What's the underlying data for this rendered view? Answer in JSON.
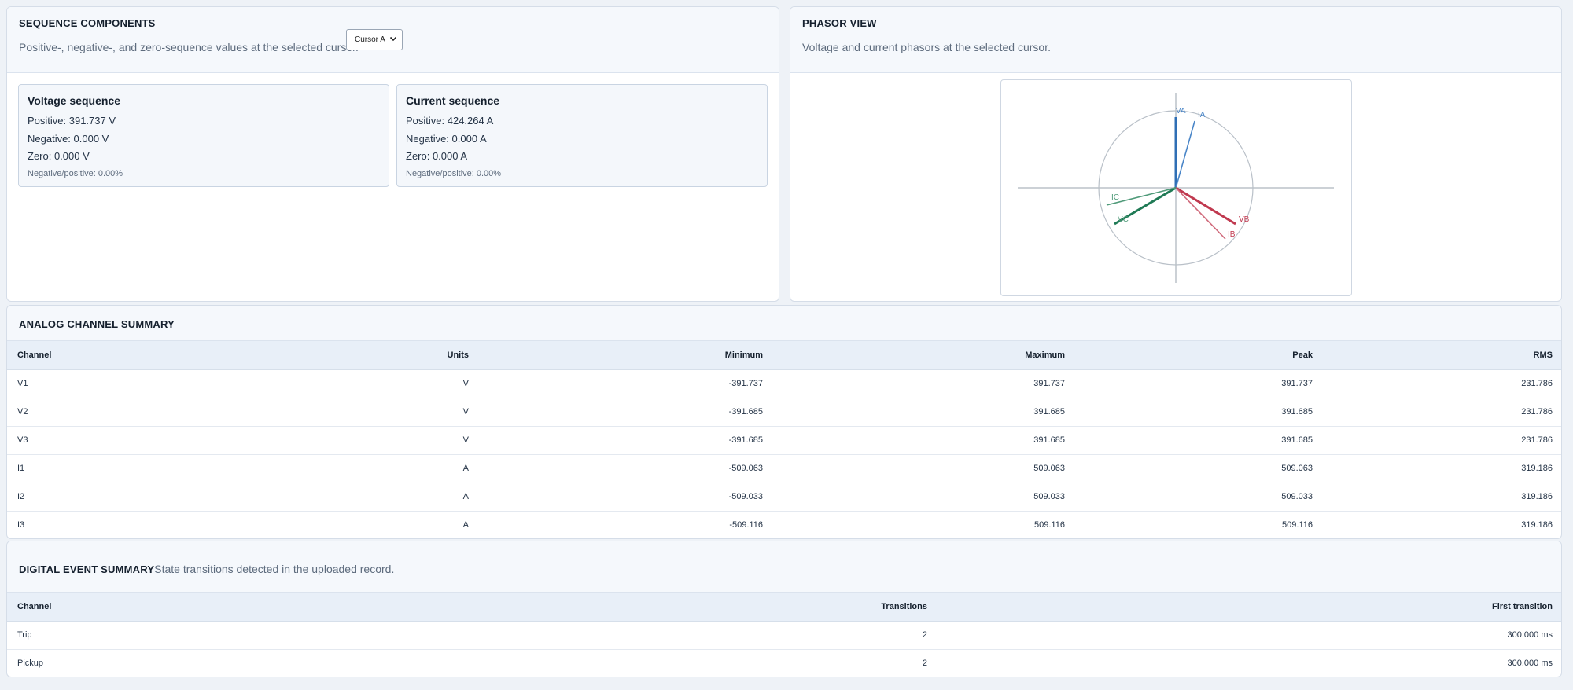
{
  "sequence": {
    "title": "SEQUENCE COMPONENTS",
    "description": "Positive-, negative-, and zero-sequence values at the selected cursor.",
    "cursor_select": "Cursor A",
    "voltage": {
      "title": "Voltage sequence",
      "positive": "Positive: 391.737 V",
      "negative": "Negative: 0.000 V",
      "zero": "Zero: 0.000 V",
      "ratio": "Negative/positive: 0.00%"
    },
    "current": {
      "title": "Current sequence",
      "positive": "Positive: 424.264 A",
      "negative": "Negative: 0.000 A",
      "zero": "Zero: 0.000 A",
      "ratio": "Negative/positive: 0.00%"
    }
  },
  "phasor": {
    "title": "PHASOR VIEW",
    "description": "Voltage and current phasors at the selected cursor.",
    "labels": {
      "va": "VA",
      "ia": "IA",
      "vb": "VB",
      "ib": "IB",
      "vc": "VC",
      "ic": "IC"
    },
    "colors": {
      "a": "#2f6fb5",
      "b": "#c0394f",
      "c": "#1f7a55"
    }
  },
  "analog": {
    "title": "ANALOG CHANNEL SUMMARY",
    "columns": [
      "Channel",
      "Units",
      "Minimum",
      "Maximum",
      "Peak",
      "RMS"
    ],
    "rows": [
      [
        "V1",
        "V",
        "-391.737",
        "391.737",
        "391.737",
        "231.786"
      ],
      [
        "V2",
        "V",
        "-391.685",
        "391.685",
        "391.685",
        "231.786"
      ],
      [
        "V3",
        "V",
        "-391.685",
        "391.685",
        "391.685",
        "231.786"
      ],
      [
        "I1",
        "A",
        "-509.063",
        "509.063",
        "509.063",
        "319.186"
      ],
      [
        "I2",
        "A",
        "-509.033",
        "509.033",
        "509.033",
        "319.186"
      ],
      [
        "I3",
        "A",
        "-509.116",
        "509.116",
        "509.116",
        "319.186"
      ]
    ]
  },
  "digital": {
    "title": "DIGITAL EVENT SUMMARY",
    "description": "State transitions detected in the uploaded record.",
    "columns": [
      "Channel",
      "Transitions",
      "First transition"
    ],
    "rows": [
      [
        "Trip",
        "2",
        "300.000 ms"
      ],
      [
        "Pickup",
        "2",
        "300.000 ms"
      ]
    ]
  }
}
